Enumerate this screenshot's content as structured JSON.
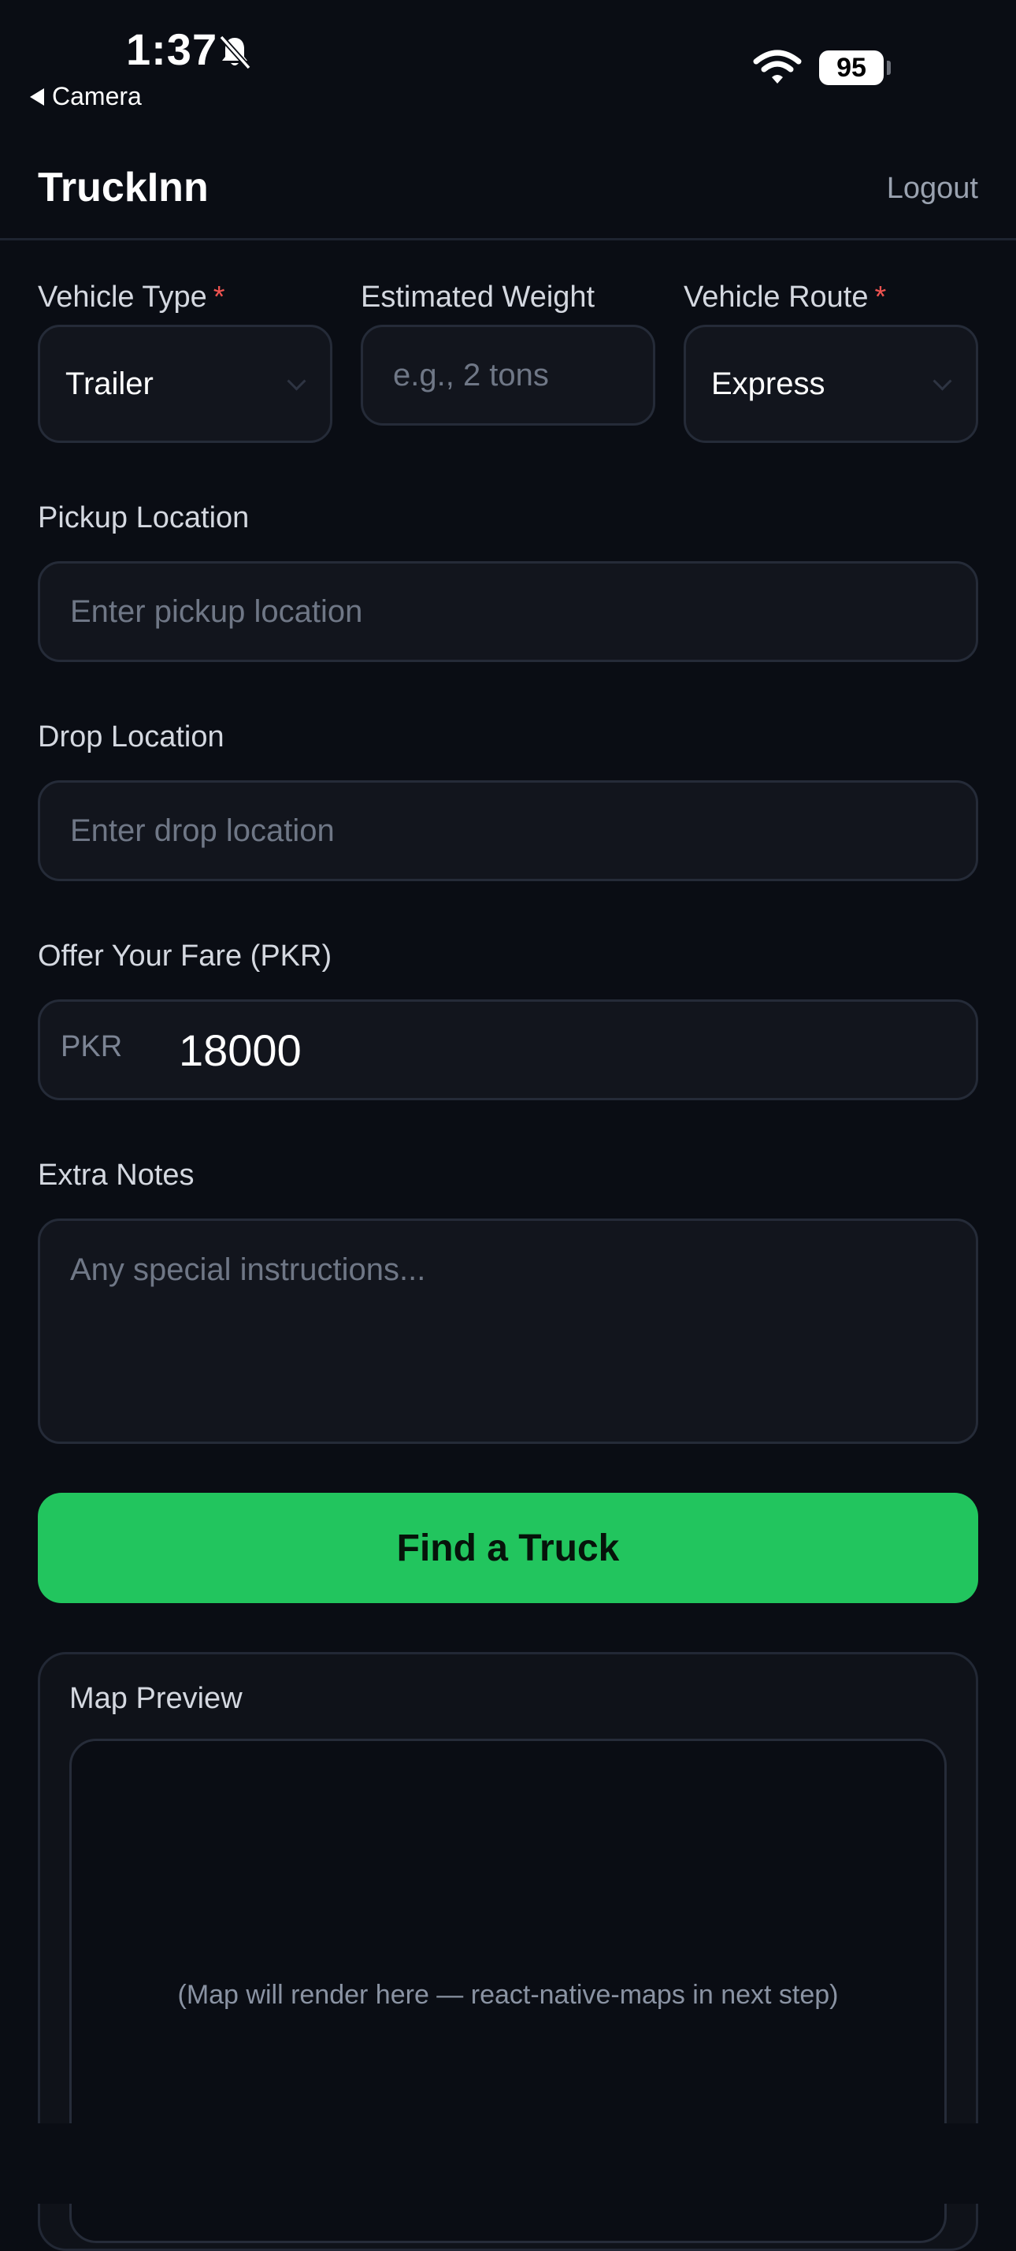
{
  "status_bar": {
    "time": "1:37",
    "back_label": "Camera",
    "battery": "95"
  },
  "header": {
    "title": "TruckInn",
    "logout_label": "Logout"
  },
  "form": {
    "vehicle_type": {
      "label": "Vehicle Type",
      "required_mark": "*",
      "value": "Trailer"
    },
    "estimated_weight": {
      "label": "Estimated Weight",
      "placeholder": "e.g., 2 tons"
    },
    "vehicle_route": {
      "label": "Vehicle Route",
      "required_mark": "*",
      "value": "Express"
    },
    "pickup": {
      "label": "Pickup Location",
      "placeholder": "Enter pickup location"
    },
    "drop": {
      "label": "Drop Location",
      "placeholder": "Enter drop location"
    },
    "fare": {
      "label": "Offer Your Fare (PKR)",
      "prefix": "PKR",
      "value": "18000"
    },
    "notes": {
      "label": "Extra Notes",
      "placeholder": "Any special instructions..."
    },
    "submit_label": "Find a Truck"
  },
  "map": {
    "title": "Map Preview",
    "placeholder": "(Map will render here — react-native-maps in next step)"
  },
  "colors": {
    "background": "#0a0d14",
    "accent": "#22c55e",
    "required": "#ef5350"
  }
}
